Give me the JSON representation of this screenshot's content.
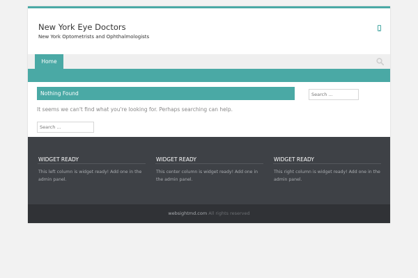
{
  "colors": {
    "accent": "#4aa9a5",
    "nav_bg": "#efefef",
    "widgets_bg": "#3e4146",
    "footer_bg": "#303236"
  },
  "header": {
    "site_title": "New York Eye Doctors",
    "tagline": "New York Optometrists and Ophthalmologists",
    "mobile_icon": "mobile-phone-icon"
  },
  "nav": {
    "home_label": "Home",
    "search_icon": "search-icon"
  },
  "content": {
    "title": "Nothing Found",
    "message": "It seems we can't find what you're looking for. Perhaps searching can help.",
    "search_placeholder": "Search ..."
  },
  "sidebar": {
    "search_placeholder": "Search ..."
  },
  "widgets": [
    {
      "title": "WIDGET READY",
      "text": "This left column is widget ready! Add one in the admin panel."
    },
    {
      "title": "WIDGET READY",
      "text": "This center column is widget ready! Add one in the admin panel."
    },
    {
      "title": "WIDGET READY",
      "text": "This right column is widget ready! Add one in the admin panel."
    }
  ],
  "footer": {
    "link_text": "websightmd.com",
    "rights": " All rights reserved"
  }
}
